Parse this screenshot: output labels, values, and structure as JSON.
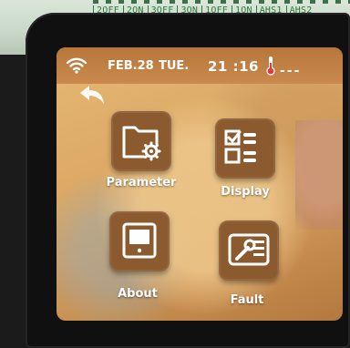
{
  "pcb": {
    "switch_labels": [
      "2OFF",
      "2ON",
      "3OFF",
      "3ON",
      "1OFF",
      "1ON",
      "AHS1",
      "AHS2"
    ]
  },
  "status_bar": {
    "date": "FEB.28",
    "weekday": "TUE.",
    "time": "21 :16",
    "temperature": "---",
    "icons": [
      "wifi-icon",
      "thermometer-icon"
    ]
  },
  "menu": {
    "items": [
      {
        "label": "Parameter",
        "icon": "folder-gear-icon"
      },
      {
        "label": "Display",
        "icon": "checklist-icon"
      },
      {
        "label": "About",
        "icon": "monitor-icon"
      },
      {
        "label": "Fault",
        "icon": "wrench-card-icon"
      }
    ]
  },
  "colors": {
    "tile": "#8b5a2f",
    "status_bar": "#b7763a",
    "text": "#ffffff"
  }
}
